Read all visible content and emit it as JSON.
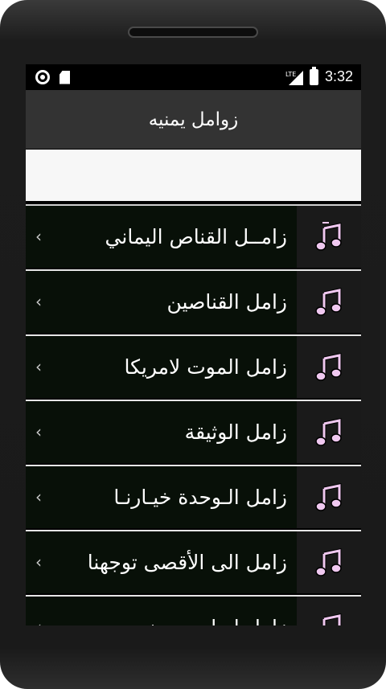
{
  "status_bar": {
    "network": "LTE",
    "time": "3:32"
  },
  "app_bar": {
    "title": "زوامل يمنيه"
  },
  "search": {
    "value": ""
  },
  "list": {
    "items": [
      {
        "label": "زامــل القناص اليماني",
        "icon": "music-note-icon"
      },
      {
        "label": "زامل القناصين",
        "icon": "music-note-icon"
      },
      {
        "label": "زامل الموت لامريكا",
        "icon": "music-note-icon"
      },
      {
        "label": "زامل الوثيقة",
        "icon": "music-note-icon"
      },
      {
        "label": "زامل الـوحدة خيـارنـا",
        "icon": "music-note-icon"
      },
      {
        "label": "زامل الى الأقصى توجهنا",
        "icon": "music-note-icon"
      },
      {
        "label": "زامل اسامه بن زيد",
        "icon": "music-note-icon"
      }
    ],
    "chevron": "‹"
  },
  "colors": {
    "app_bar": "#333333",
    "row_background": "#081008",
    "icon_fill": "#f0c8f0"
  }
}
